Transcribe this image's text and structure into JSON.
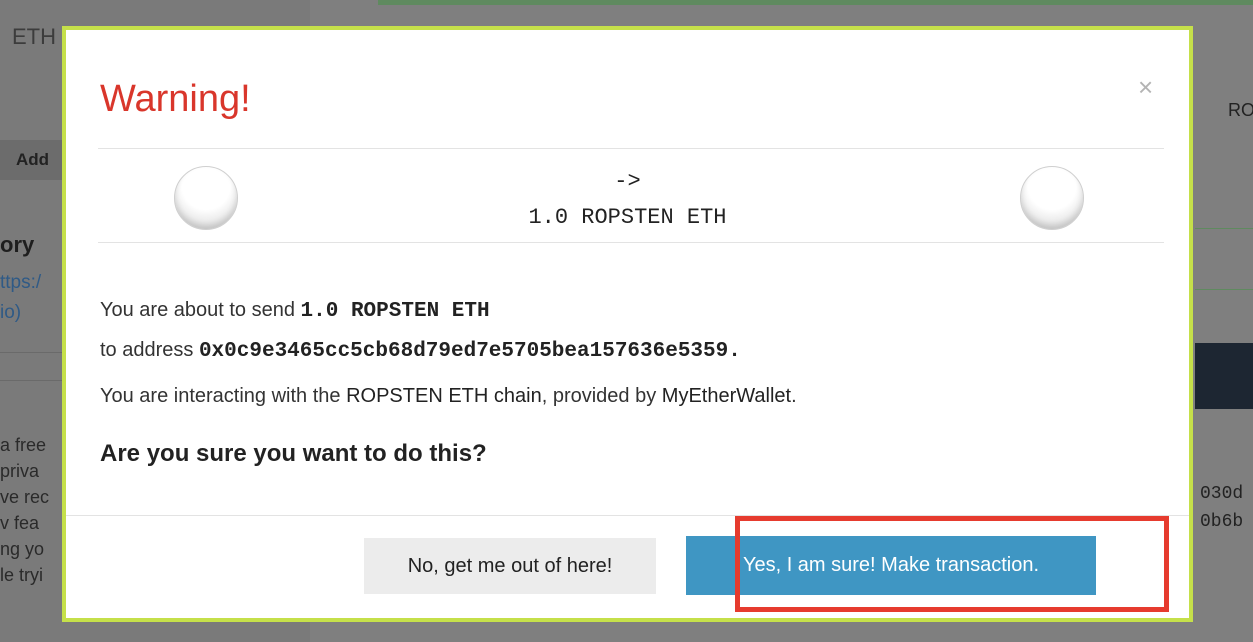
{
  "background": {
    "eth_label": "ETH",
    "add_label": "Add",
    "history_fragment": "ory",
    "link_fragment_1": "ttps:/",
    "link_fragment_2": "io)",
    "para_fragments": [
      "a free",
      "priva",
      "ve rec",
      "v fea",
      "ng yo",
      "le tryi"
    ],
    "ro_fragment": "RO",
    "code_fragment_1": "030d",
    "code_fragment_2": "0b6b"
  },
  "modal": {
    "title": "Warning!",
    "close_glyph": "×",
    "arrow": "->",
    "amount": "1.0 ROPSTEN ETH",
    "line1_prefix": "You are about to send ",
    "line1_amount": "1.0 ROPSTEN ETH",
    "line2_prefix": "to address ",
    "line2_address": "0x0c9e3465cc5cb68d79ed7e5705bea157636e5359.",
    "line3_prefix": "You are interacting with the ",
    "line3_chain": "ROPSTEN ETH chain",
    "line3_middle": ", provided by ",
    "line3_provider": "MyEtherWallet",
    "line3_suffix": ".",
    "question": "Are you sure you want to do this?",
    "cancel_label": "No, get me out of here!",
    "confirm_label": "Yes, I am sure! Make transaction."
  },
  "colors": {
    "warning_red": "#d9362b",
    "modal_border": "#c5e04a",
    "confirm_blue": "#3f96c3",
    "highlight_red": "#e63b2e"
  }
}
